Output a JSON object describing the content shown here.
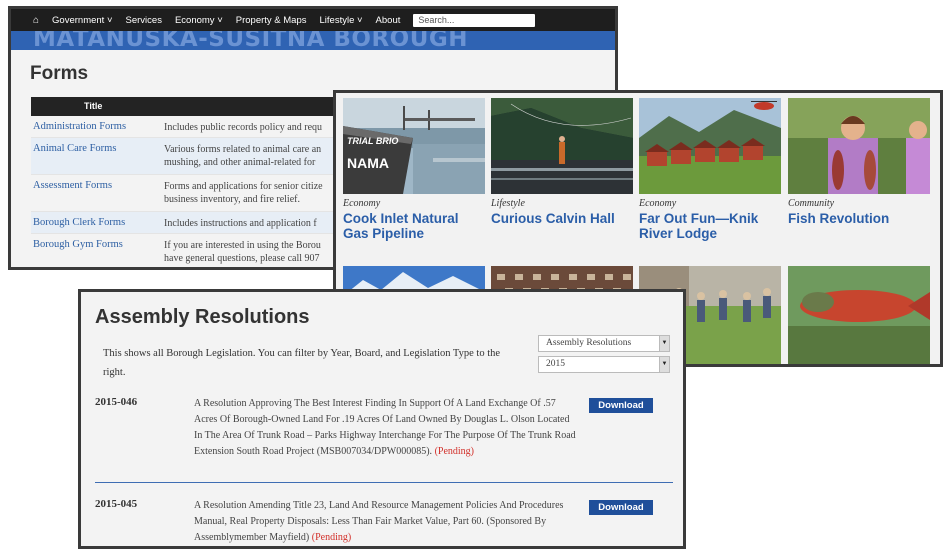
{
  "forms_page": {
    "nav": {
      "home_icon": "home-icon",
      "items": [
        "Government ˅",
        "Services",
        "Economy ˅",
        "Property & Maps",
        "Lifestyle ˅",
        "About"
      ],
      "search_placeholder": "Search..."
    },
    "banner_text": "MATANUSKA-SUSITNA BOROUGH",
    "title": "Forms",
    "table": {
      "header": "Title",
      "rows": [
        {
          "name": "Administration Forms",
          "desc": "Includes public records policy and requ"
        },
        {
          "name": "Animal Care Forms",
          "desc": "Various forms related to animal care an",
          "desc2": "mushing, and other animal-related for"
        },
        {
          "name": "Assessment Forms",
          "desc": "Forms and applications for senior citize",
          "desc2": "business inventory, and fire relief."
        },
        {
          "name": "Borough Clerk Forms",
          "desc": "Includes instructions and application f"
        },
        {
          "name": "Borough Gym Forms",
          "desc": "If you are interested in using the Borou",
          "desc2": "have general questions, please call 907"
        }
      ]
    }
  },
  "stories": [
    {
      "category": "Economy",
      "title": "Cook Inlet Natural Gas Pipeline",
      "photo_text": "TRIAL BRIO",
      "photo_text2": "NAMA"
    },
    {
      "category": "Lifestyle",
      "title": "Curious Calvin Hall"
    },
    {
      "category": "Economy",
      "title": "Far Out Fun—Knik River Lodge"
    },
    {
      "category": "Community",
      "title": "Fish Revolution"
    }
  ],
  "resolutions": {
    "title": "Assembly Resolutions",
    "intro": "This shows all Borough Legislation. You can filter by Year, Board, and Legislation Type to the right.",
    "filters": {
      "type": "Assembly Resolutions",
      "year": "2015"
    },
    "items": [
      {
        "number": "2015-046",
        "text": "A Resolution Approving The Best Interest Finding In Support Of A Land Exchange Of .57 Acres Of Borough-Owned Land For .19 Acres Of Land Owned By Douglas L. Olson Located In The Area Of Trunk Road – Parks Highway Interchange For The Purpose Of The Trunk Road Extension South Road Project (MSB007034/DPW000085).",
        "status": "(Pending)",
        "button": "Download"
      },
      {
        "number": "2015-045",
        "text": "A Resolution Amending Title 23, Land And Resource Management Policies And Procedures Manual, Real Property Disposals: Less Than Fair Market Value, Part 60. (Sponsored By Assemblymember Mayfield)",
        "status": "(Pending)",
        "button": "Download"
      }
    ]
  }
}
